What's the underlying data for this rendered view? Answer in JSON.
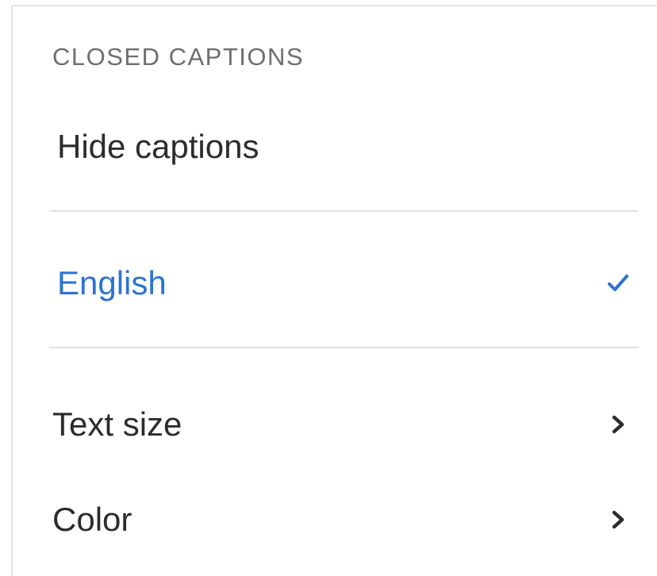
{
  "captions_menu": {
    "header": "CLOSED CAPTIONS",
    "items": [
      {
        "label": "Hide captions",
        "selected": false
      },
      {
        "label": "English",
        "selected": true,
        "trailing_icon": "checkmark-icon"
      }
    ],
    "settings": [
      {
        "label": "Text size",
        "trailing_icon": "chevron-right-icon"
      },
      {
        "label": "Color",
        "trailing_icon": "chevron-right-icon"
      }
    ]
  },
  "colors": {
    "selected_text": "#2c72d2",
    "default_text": "#2c2c2c",
    "header_text": "#6e6e6e",
    "divider": "#e1e1e1"
  }
}
